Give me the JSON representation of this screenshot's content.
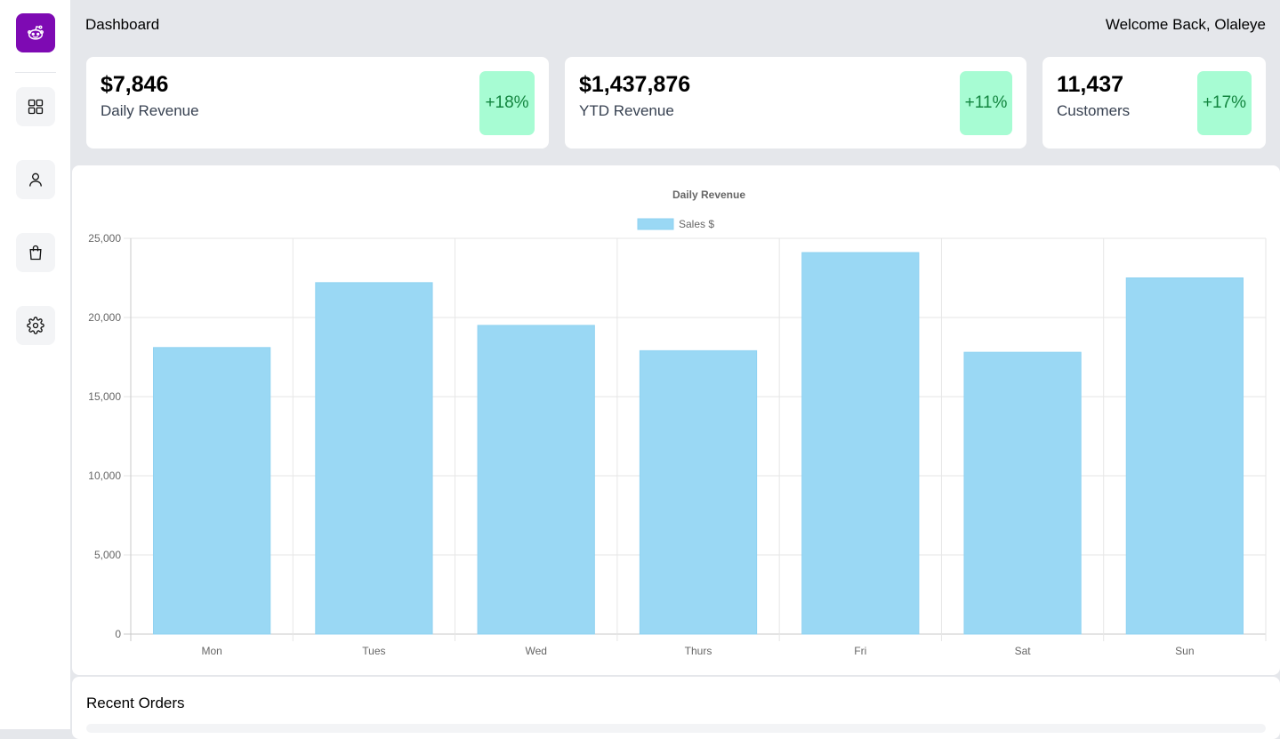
{
  "header": {
    "title": "Dashboard",
    "welcome": "Welcome Back, Olaleye"
  },
  "sidebar": {
    "logo_icon": "reddit-alien-icon",
    "items": [
      {
        "icon": "grid-icon"
      },
      {
        "icon": "user-icon"
      },
      {
        "icon": "shopping-bag-icon"
      },
      {
        "icon": "gear-icon"
      }
    ]
  },
  "stats": [
    {
      "value": "$7,846",
      "label": "Daily Revenue",
      "change": "+18%"
    },
    {
      "value": "$1,437,876",
      "label": "YTD Revenue",
      "change": "+11%"
    },
    {
      "value": "11,437",
      "label": "Customers",
      "change": "+17%"
    }
  ],
  "colors": {
    "brand": "#7e0ab3",
    "badge_bg": "#a7fcd3",
    "badge_text": "#12853f",
    "bar": "#9ad8f4"
  },
  "chart_data": {
    "type": "bar",
    "title": "Daily Revenue",
    "categories": [
      "Mon",
      "Tues",
      "Wed",
      "Thurs",
      "Fri",
      "Sat",
      "Sun"
    ],
    "series": [
      {
        "name": "Sales $",
        "values": [
          18100,
          22200,
          19500,
          17900,
          24100,
          17800,
          22500
        ]
      }
    ],
    "ylim": [
      0,
      25000
    ],
    "yticks": [
      "0",
      "5,000",
      "10,000",
      "15,000",
      "20,000",
      "25,000"
    ],
    "grid": true,
    "legend": "top-center"
  },
  "orders": {
    "title": "Recent Orders"
  }
}
